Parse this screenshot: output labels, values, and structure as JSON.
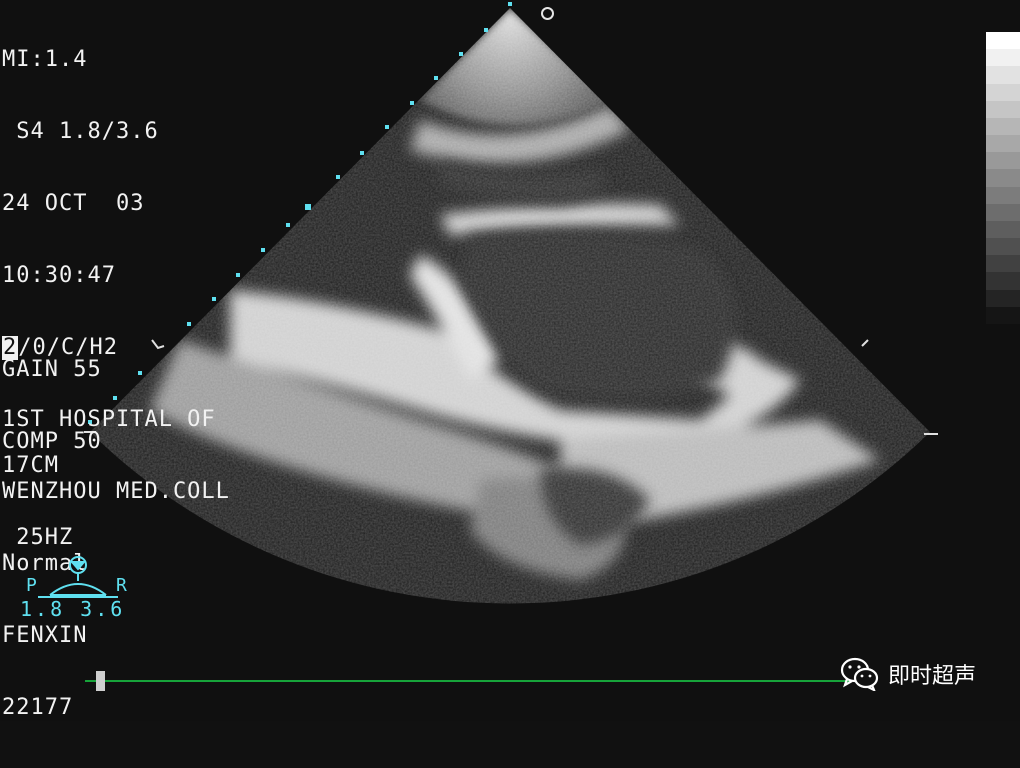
{
  "info": {
    "line1": "MI:1.4",
    "line2": " S4 1.8/3.6",
    "line3": "24 OCT  03",
    "line4": "10:30:47",
    "mode_box": "2",
    "mode_rest": "/0/C/H2",
    "line6": "1ST HOSPITAL OF",
    "line7": "WENZHOU MED.COLL",
    "line8": "Normal",
    "line9": "FENXIN",
    "line10": "22177"
  },
  "settings": {
    "gain": "GAIN 55",
    "comp": "COMP 50"
  },
  "depth": {
    "depth": "17CM",
    "frame_rate": " 25HZ"
  },
  "probe": {
    "left_label": "P",
    "right_label": "R",
    "freq": "1.8 3.6",
    "icon": "probe-orientation-icon"
  },
  "grayscale": [
    "#ffffff",
    "#f1f1f1",
    "#e2e2e2",
    "#d4d4d4",
    "#c5c5c5",
    "#b6b6b6",
    "#a8a8a8",
    "#999999",
    "#8a8a8a",
    "#7c7c7c",
    "#6d6d6d",
    "#5e5e5e",
    "#505050",
    "#414141",
    "#333333",
    "#242424",
    "#151515"
  ],
  "colors": {
    "overlay_text": "#f2f2f2",
    "cyan": "#5fe0f0",
    "timeline": "#17a33a"
  },
  "watermark": {
    "text": "即时超声",
    "icon": "wechat-icon"
  }
}
